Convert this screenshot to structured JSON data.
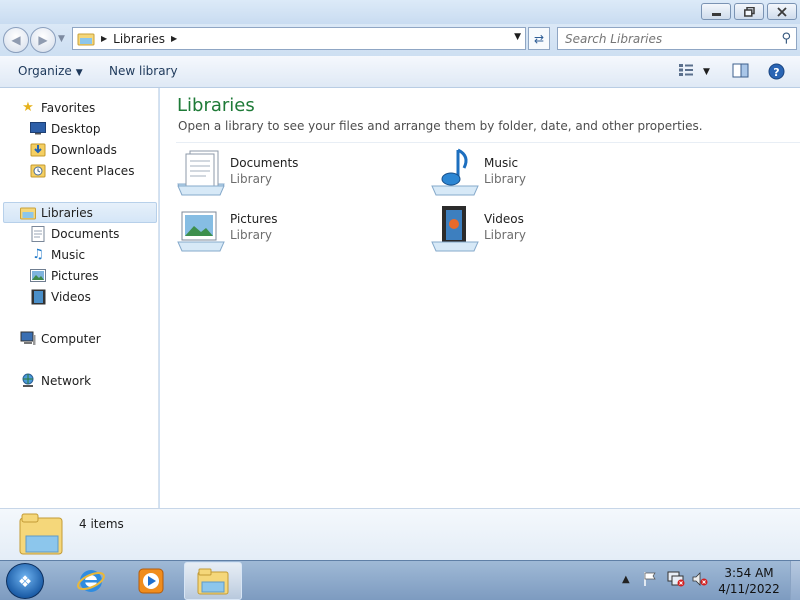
{
  "window": {
    "controls": [
      "minimize-icon",
      "restore-icon",
      "close-icon"
    ]
  },
  "address": {
    "crumb": "Libraries",
    "search_placeholder": "Search Libraries"
  },
  "toolbar": {
    "organize_label": "Organize",
    "new_library_label": "New library"
  },
  "sidebar": {
    "favorites": {
      "label": "Favorites",
      "icon": "star-icon"
    },
    "favorite_items": [
      {
        "label": "Desktop",
        "icon": "desktop-icon"
      },
      {
        "label": "Downloads",
        "icon": "downloads-icon"
      },
      {
        "label": "Recent Places",
        "icon": "recent-places-icon"
      }
    ],
    "libraries": {
      "label": "Libraries",
      "icon": "libraries-icon"
    },
    "library_items": [
      {
        "label": "Documents",
        "icon": "documents-icon"
      },
      {
        "label": "Music",
        "icon": "music-icon"
      },
      {
        "label": "Pictures",
        "icon": "pictures-icon"
      },
      {
        "label": "Videos",
        "icon": "videos-icon"
      }
    ],
    "computer": {
      "label": "Computer",
      "icon": "computer-icon"
    },
    "network": {
      "label": "Network",
      "icon": "network-icon"
    }
  },
  "main": {
    "title": "Libraries",
    "subtitle": "Open a library to see your files and arrange them by folder, date, and other properties.",
    "libraries": [
      {
        "name": "Documents",
        "type": "Library",
        "icon": "documents-library-icon"
      },
      {
        "name": "Music",
        "type": "Library",
        "icon": "music-library-icon"
      },
      {
        "name": "Pictures",
        "type": "Library",
        "icon": "pictures-library-icon"
      },
      {
        "name": "Videos",
        "type": "Library",
        "icon": "videos-library-icon"
      }
    ]
  },
  "details": {
    "item_count": "4 items"
  },
  "taskbar": {
    "apps": [
      "internet-explorer-icon",
      "media-player-icon",
      "windows-explorer-icon"
    ],
    "time": "3:54 AM",
    "date": "4/11/2022"
  },
  "colors": {
    "title_green": "#1e7a37",
    "selection_blue": "#d5e6f7",
    "taskbar_blue": "#7d9bc0"
  }
}
